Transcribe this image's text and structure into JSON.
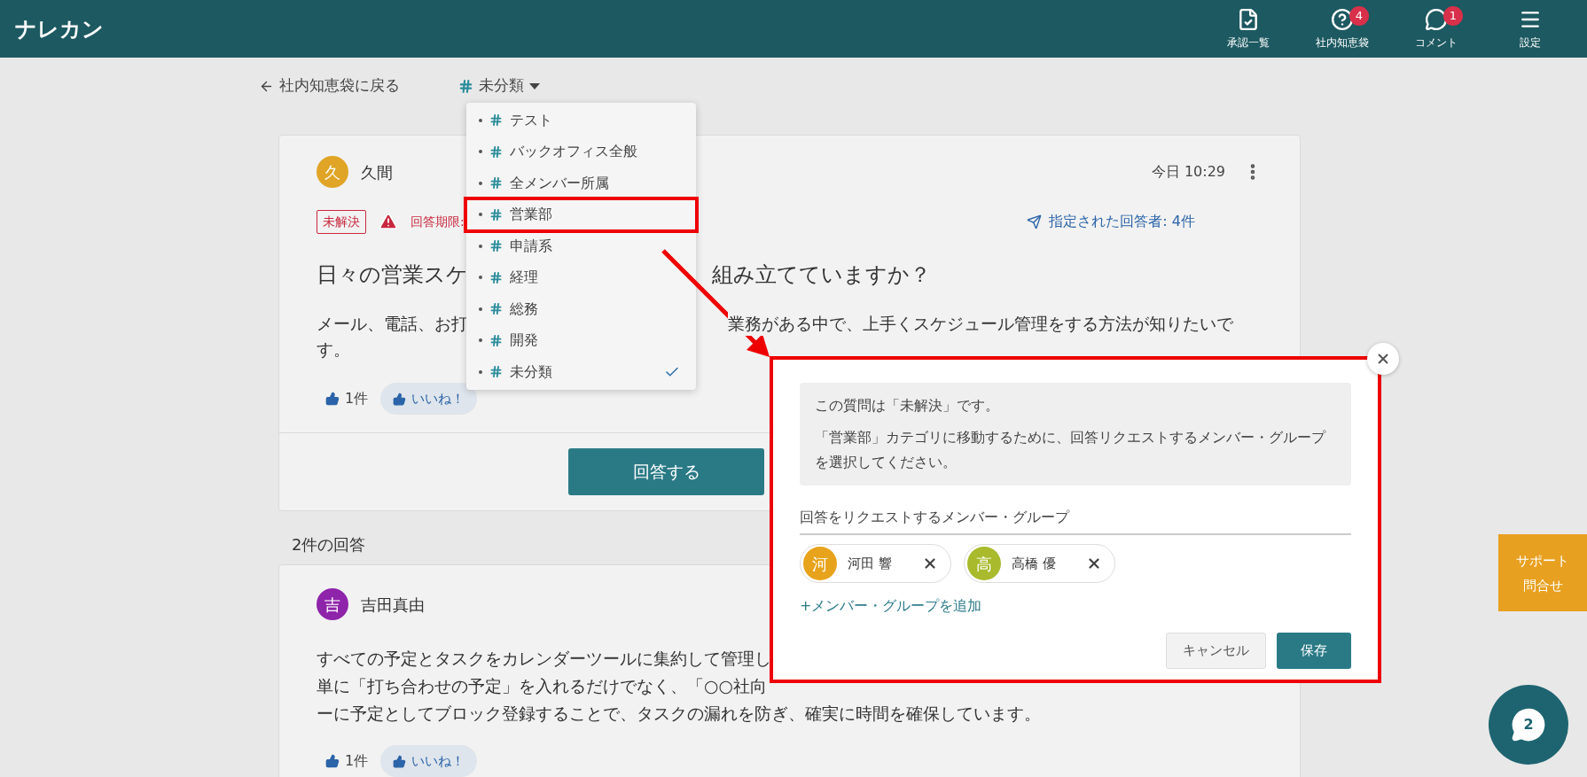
{
  "header": {
    "logo": "ナレカン",
    "nav": [
      {
        "label": "承認一覧"
      },
      {
        "label": "社内知恵袋",
        "badge": "4"
      },
      {
        "label": "コメント",
        "badge": "1"
      },
      {
        "label": "設定"
      }
    ]
  },
  "back_link": "社内知恵袋に戻る",
  "category": {
    "label": "未分類",
    "expanded": true
  },
  "category_menu": [
    {
      "label": "テスト",
      "selected": false,
      "annotated": false
    },
    {
      "label": "バックオフィス全般",
      "selected": false,
      "annotated": false
    },
    {
      "label": "全メンバー所属",
      "selected": false,
      "annotated": false
    },
    {
      "label": "営業部",
      "selected": false,
      "annotated": true
    },
    {
      "label": "申請系",
      "selected": false,
      "annotated": false
    },
    {
      "label": "経理",
      "selected": false,
      "annotated": false
    },
    {
      "label": "総務",
      "selected": false,
      "annotated": false
    },
    {
      "label": "開発",
      "selected": false,
      "annotated": false
    },
    {
      "label": "未分類",
      "selected": true,
      "annotated": false
    }
  ],
  "question": {
    "author": {
      "initial": "久",
      "name": "久間",
      "color": "#e0a526"
    },
    "time": "今日 10:29",
    "status": "未解決",
    "deadline": "回答期限:",
    "assignees": "指定された回答者: 4件",
    "title_left": "日々の営業スケ",
    "title_right": "組み立てていますか？",
    "body_left": "メール、電話、お打",
    "body_right": "業務がある中で、上手くスケジュール管理をする方法が知りたいで",
    "body_end": "す。",
    "likes": "1件",
    "like_button": "いいね！",
    "answer_button": "回答する"
  },
  "answers": {
    "heading": "2件の回答",
    "items": [
      {
        "author": {
          "initial": "吉",
          "name": "吉田真由",
          "color": "#8e24aa"
        },
        "lines": [
          "すべての予定とタスクをカレンダーツールに集約して管理し",
          "単に「打ち合わせの予定」を入れるだけでなく、「○○社向",
          "ーに予定としてブロック登録することで、タスクの漏れを防ぎ、確実に時間を確保しています。"
        ],
        "likes": "1件",
        "like_button": "いいね！"
      }
    ]
  },
  "modal": {
    "annotated": true,
    "notice": [
      "この質問は「未解決」です。",
      "「営業部」カテゴリに移動するために、回答リクエストするメンバー・グループを選択してください。"
    ],
    "field_label": "回答をリクエストするメンバー・グループ",
    "members": [
      {
        "initial": "河",
        "name": "河田 響",
        "color": "#e8a31c"
      },
      {
        "initial": "高",
        "name": "高橋 優",
        "color": "#a9ba2c"
      }
    ],
    "add_link": "+メンバー・グループを追加",
    "cancel": "キャンセル",
    "save": "保存"
  },
  "support": [
    "サポート",
    "問合せ"
  ],
  "chat": {
    "count": "2"
  }
}
